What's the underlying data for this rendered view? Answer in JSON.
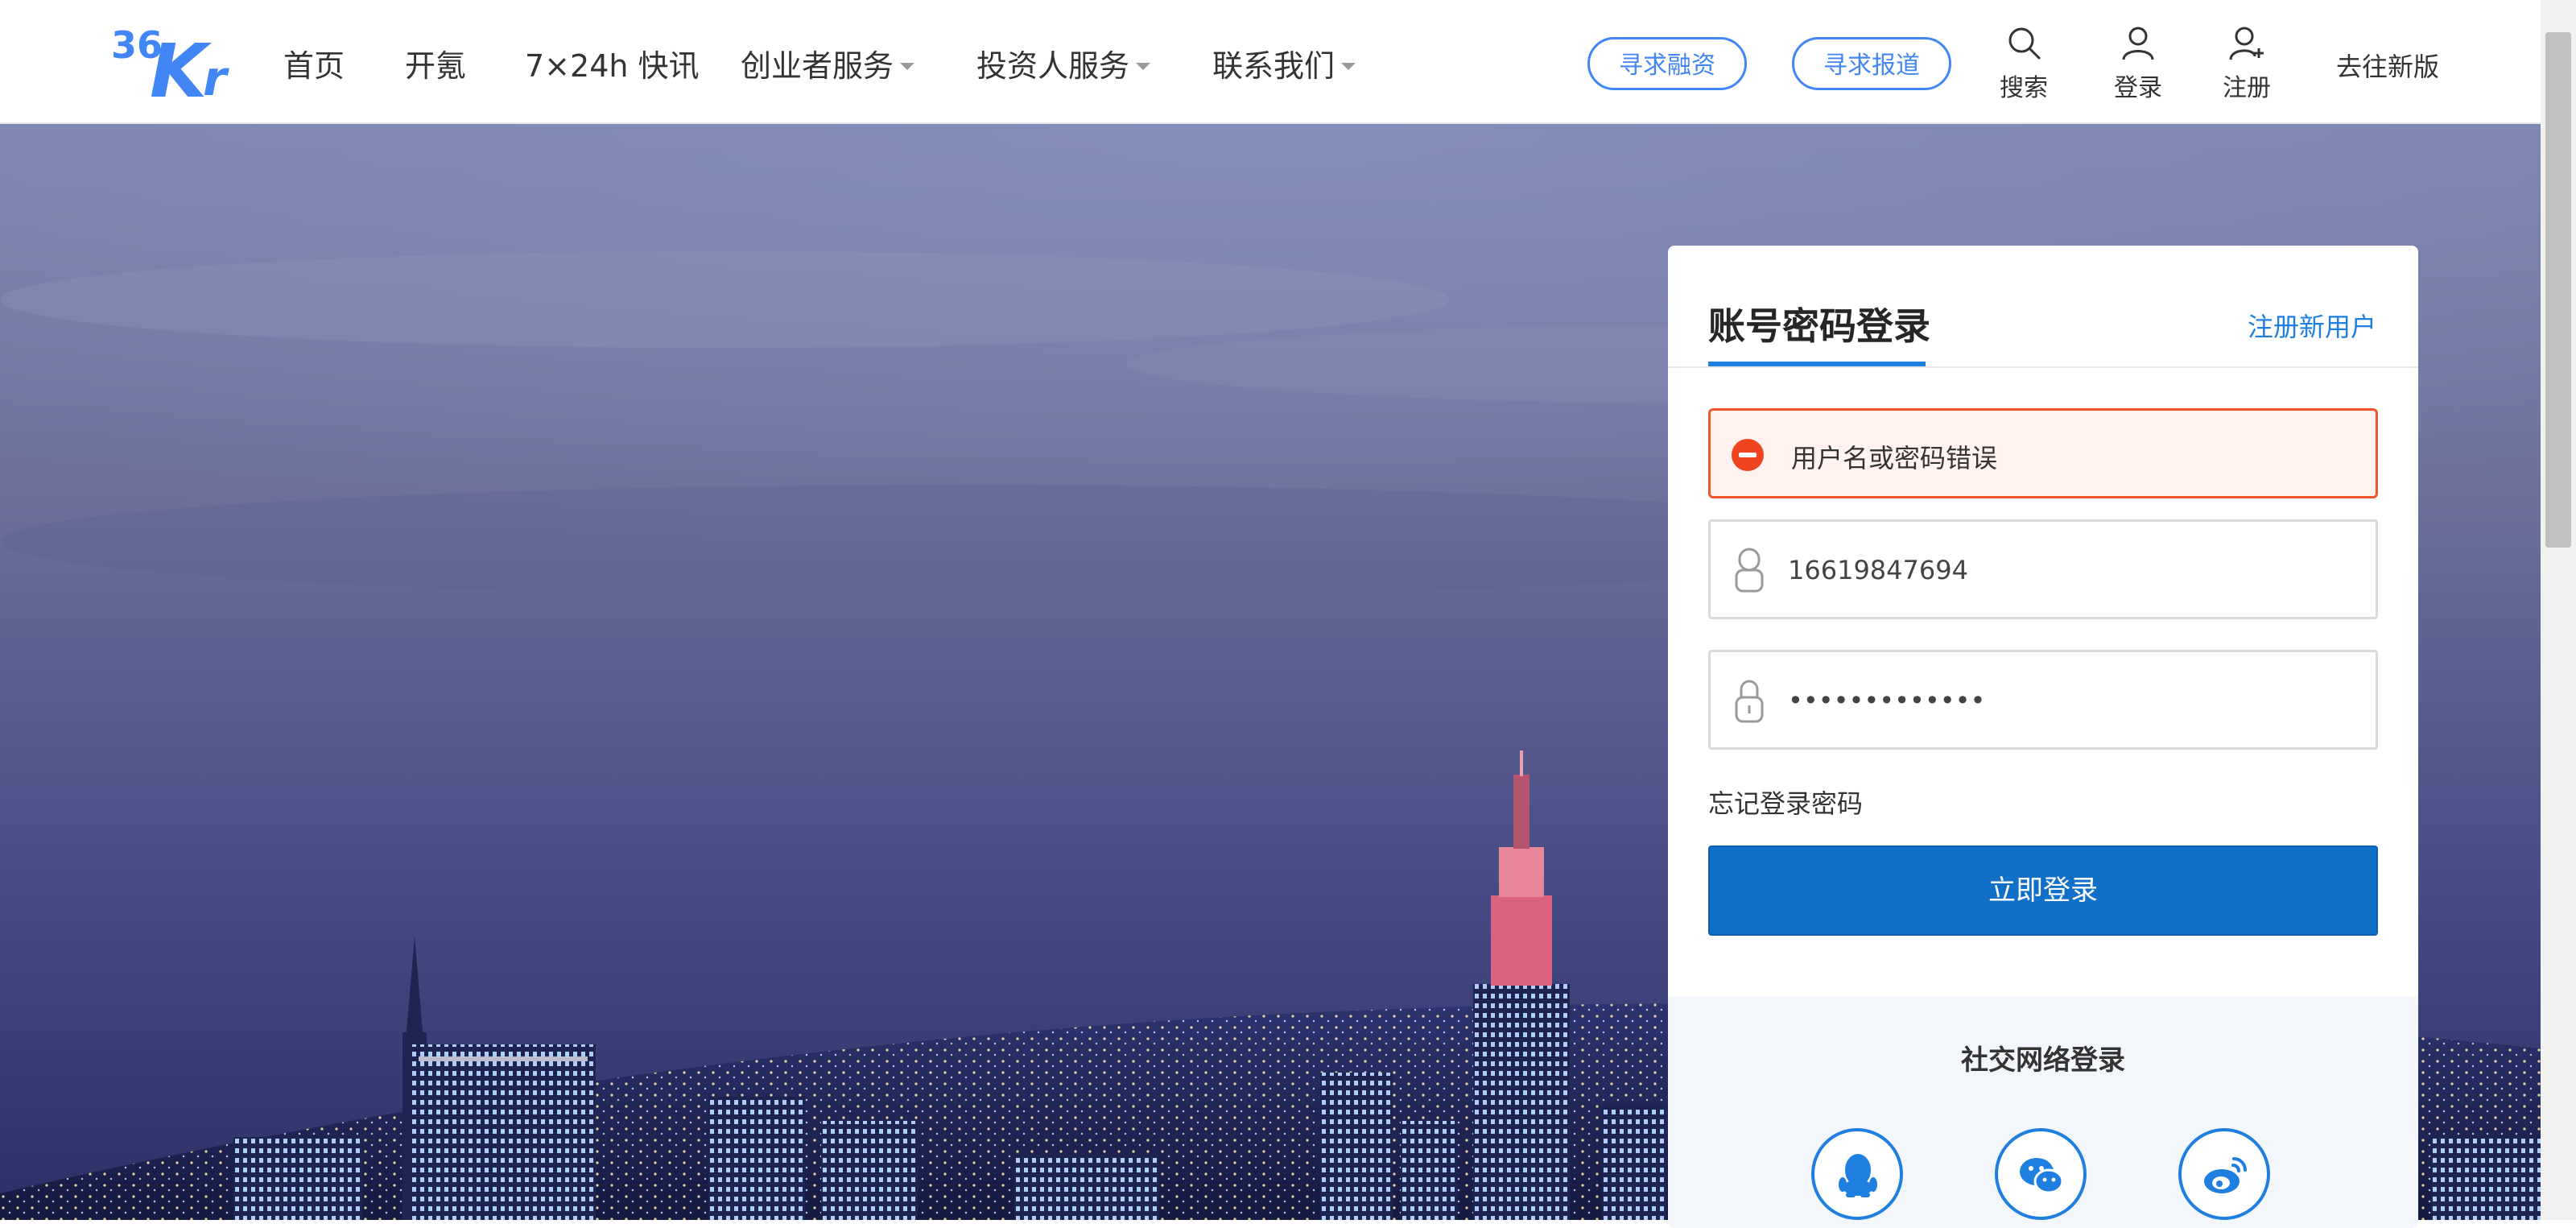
{
  "header": {
    "logo_alt": "36Kr",
    "nav": [
      {
        "label": "首页",
        "has_dropdown": false
      },
      {
        "label": "开氪",
        "has_dropdown": false
      },
      {
        "label": "7×24h 快讯",
        "has_dropdown": false
      },
      {
        "label": "创业者服务",
        "has_dropdown": true
      },
      {
        "label": "投资人服务",
        "has_dropdown": true
      },
      {
        "label": "联系我们",
        "has_dropdown": true
      }
    ],
    "pill_buttons": [
      {
        "label": "寻求融资"
      },
      {
        "label": "寻求报道"
      }
    ],
    "icon_actions": [
      {
        "label": "搜索",
        "icon": "search-icon"
      },
      {
        "label": "登录",
        "icon": "user-icon"
      },
      {
        "label": "注册",
        "icon": "user-add-icon"
      }
    ],
    "new_version_label": "去往新版"
  },
  "login": {
    "title": "账号密码登录",
    "register_link": "注册新用户",
    "error_message": "用户名或密码错误",
    "username": {
      "value": "16619847694",
      "icon": "user-outline-icon"
    },
    "password": {
      "value": "•••••••••••••",
      "icon": "lock-icon"
    },
    "forgot_label": "忘记登录密码",
    "submit_label": "立即登录"
  },
  "social": {
    "title": "社交网络登录",
    "providers": [
      {
        "name": "qq",
        "icon": "qq-icon"
      },
      {
        "name": "wechat",
        "icon": "wechat-icon"
      },
      {
        "name": "weibo",
        "icon": "weibo-icon"
      }
    ]
  },
  "colors": {
    "brand_blue": "#4285f4",
    "link_blue": "#1e7fe0",
    "button_blue": "#1070c8",
    "error_red": "#f0431f",
    "error_bg": "#fff2ef"
  }
}
